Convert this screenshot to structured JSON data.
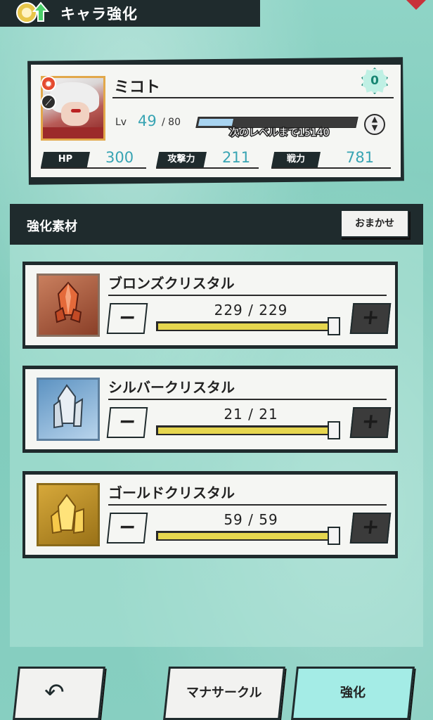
{
  "header": {
    "title": "キャラ強化"
  },
  "character": {
    "name": "ミコト",
    "limit_break": "0",
    "lv_label": "Lv",
    "lv_current": "49",
    "lv_max": "/ 80",
    "exp_progress": 0.22,
    "exp_text": "次のレベルまで15140",
    "stats": [
      {
        "label": "HP",
        "value": "300"
      },
      {
        "label": "攻撃力",
        "value": "211"
      },
      {
        "label": "戦力",
        "value": "781"
      }
    ]
  },
  "materials_panel": {
    "title": "強化素材",
    "omakase_label": "おまかせ",
    "items": [
      {
        "name": "ブロンズクリスタル",
        "count": "229 / 229",
        "fill": 1.0,
        "icon": "bronze-crystal-icon",
        "color": "#b8613f"
      },
      {
        "name": "シルバークリスタル",
        "count": "21  / 21",
        "fill": 1.0,
        "icon": "silver-crystal-icon",
        "color": "#6aa4d0"
      },
      {
        "name": "ゴールドクリスタル",
        "count": "59  / 59",
        "fill": 1.0,
        "icon": "gold-crystal-icon",
        "color": "#d6a83a"
      }
    ],
    "minus_label": "−",
    "plus_label": "+"
  },
  "footer": {
    "back_icon": "back-arrow-icon",
    "mana_label": "マナサークル",
    "power_label": "強化"
  },
  "colors": {
    "background": "#8fd4c6",
    "dark": "#1f2b2d",
    "accent_value": "#38a4b3",
    "slider_fill": "#e6d64e",
    "power_button": "#a4ece6"
  }
}
